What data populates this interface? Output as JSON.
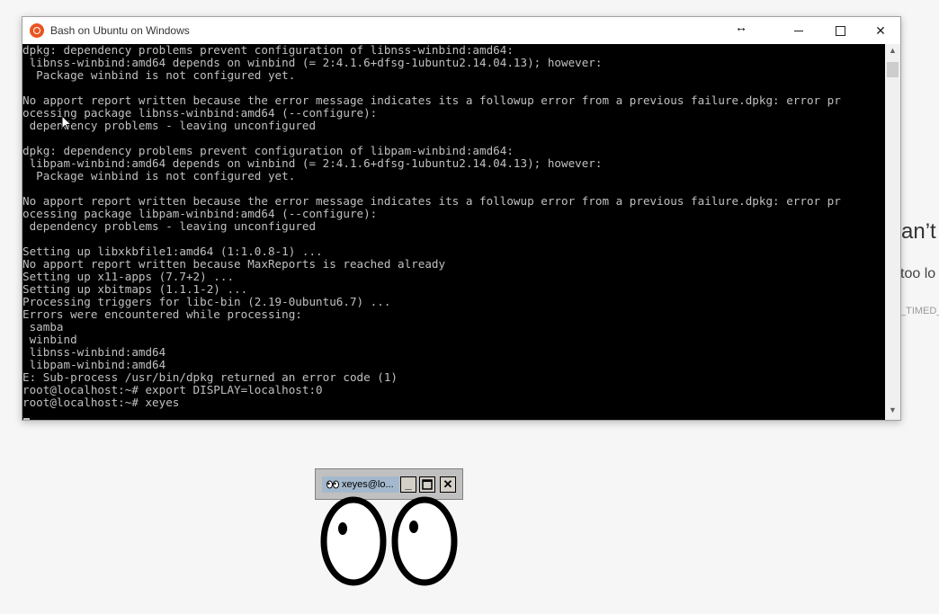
{
  "background_page": {
    "heading_fragment": "an’t",
    "text_fragment": "too lo",
    "code_fragment": "_TIMED_"
  },
  "bash_window": {
    "title": "Bash on Ubuntu on Windows",
    "icon": "ubuntu-icon",
    "terminal_lines": [
      "dpkg: dependency problems prevent configuration of libnss-winbind:amd64:",
      " libnss-winbind:amd64 depends on winbind (= 2:4.1.6+dfsg-1ubuntu2.14.04.13); however:",
      "  Package winbind is not configured yet.",
      "",
      "No apport report written because the error message indicates its a followup error from a previous failure.dpkg: error pr",
      "ocessing package libnss-winbind:amd64 (--configure):",
      " dependency problems - leaving unconfigured",
      "",
      "dpkg: dependency problems prevent configuration of libpam-winbind:amd64:",
      " libpam-winbind:amd64 depends on winbind (= 2:4.1.6+dfsg-1ubuntu2.14.04.13); however:",
      "  Package winbind is not configured yet.",
      "",
      "No apport report written because the error message indicates its a followup error from a previous failure.dpkg: error pr",
      "ocessing package libpam-winbind:amd64 (--configure):",
      " dependency problems - leaving unconfigured",
      "",
      "Setting up libxkbfile1:amd64 (1:1.0.8-1) ...",
      "No apport report written because MaxReports is reached already",
      "Setting up x11-apps (7.7+2) ...",
      "Setting up xbitmaps (1.1.1-2) ...",
      "Processing triggers for libc-bin (2.19-0ubuntu6.7) ...",
      "Errors were encountered while processing:",
      " samba",
      " winbind",
      " libnss-winbind:amd64",
      " libpam-winbind:amd64",
      "E: Sub-process /usr/bin/dpkg returned an error code (1)",
      "root@localhost:~# export DISPLAY=localhost:0",
      "root@localhost:~# xeyes"
    ]
  },
  "xeyes_window": {
    "title": "xeyes@lo...",
    "minimize_label": "_",
    "close_label": "✕"
  },
  "colors": {
    "terminal_bg": "#000000",
    "terminal_fg": "#c0c0c0",
    "ubuntu_orange": "#e95420",
    "xeyes_title_bg": "#a3b8cc"
  }
}
